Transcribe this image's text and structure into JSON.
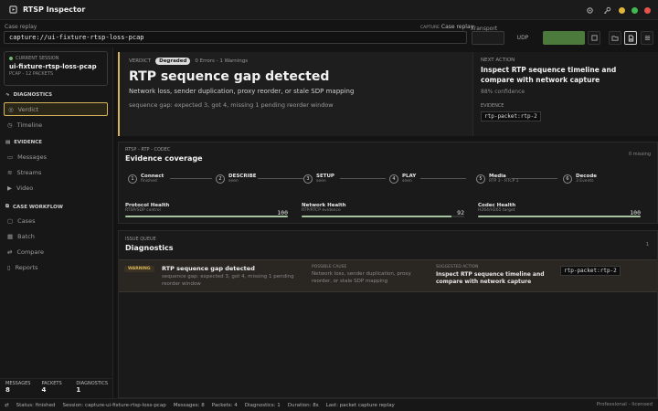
{
  "app": {
    "title": "RTSP Inspector"
  },
  "toolbar": {
    "case_replay_label": "Case replay",
    "address": "capture://ui-fixture-rtsp-loss-pcap",
    "capture_label": "CAPTURE",
    "capture_value": "Case replay",
    "transport_label": "Transport",
    "udp": "UDP"
  },
  "session": {
    "label": "CURRENT SESSION",
    "name": "ui-fixture-rtsp-loss-pcap",
    "meta": "PCAP - 12 PACKETS"
  },
  "sidebar": {
    "diagnostics": {
      "label": "DIAGNOSTICS",
      "items": [
        "Verdict",
        "Timeline"
      ]
    },
    "evidence": {
      "label": "EVIDENCE",
      "items": [
        "Messages",
        "Streams",
        "Video"
      ]
    },
    "workflow": {
      "label": "CASE WORKFLOW",
      "items": [
        "Cases",
        "Batch",
        "Compare",
        "Reports"
      ]
    }
  },
  "stats": [
    {
      "label": "MESSAGES",
      "value": "8"
    },
    {
      "label": "PACKETS",
      "value": "4"
    },
    {
      "label": "DIAGNOSTICS",
      "value": "1"
    }
  ],
  "verdict": {
    "label": "VERDICT",
    "badge": "Degraded",
    "counts": "0 Errors - 1 Warnings",
    "title": "RTP sequence gap detected",
    "subtitle": "Network loss, sender duplication, proxy reorder, or stale SDP mapping",
    "detail": "sequence gap: expected 3, got 4, missing 1 pending reorder window"
  },
  "next_action": {
    "label": "NEXT ACTION",
    "title": "Inspect RTP sequence timeline and compare with network capture",
    "confidence": "88% confidence",
    "evidence_label": "EVIDENCE",
    "evidence_chip": "rtp-packet:rtp-2"
  },
  "coverage": {
    "label": "RTSP - RTP - CODEC",
    "title": "Evidence coverage",
    "missing": "0 missing",
    "steps": [
      {
        "num": "1",
        "name": "Connect",
        "detail": "finished"
      },
      {
        "num": "2",
        "name": "DESCRIBE",
        "detail": "seen"
      },
      {
        "num": "3",
        "name": "SETUP",
        "detail": "seen"
      },
      {
        "num": "4",
        "name": "PLAY",
        "detail": "seen"
      },
      {
        "num": "5",
        "name": "Media",
        "detail": "RTP 3 - RTCP 1"
      },
      {
        "num": "6",
        "name": "Decode",
        "detail": "3 Events"
      }
    ],
    "health": [
      {
        "name": "Protocol Health",
        "sub": "RTSP/SDP control",
        "value": "100",
        "level": 100
      },
      {
        "name": "Network Health",
        "sub": "RTP/RTCP evidence",
        "value": "92",
        "level": 92
      },
      {
        "name": "Codec Health",
        "sub": "H264/H265 target",
        "value": "100",
        "level": 100
      }
    ]
  },
  "diagnostics": {
    "label": "ISSUE QUEUE",
    "title": "Diagnostics",
    "count": "1",
    "row": {
      "severity": "WARNING",
      "title": "RTP sequence gap detected",
      "detail": "sequence gap: expected 3, got 4, missing 1 pending reorder window",
      "cause_label": "POSSIBLE CAUSE",
      "cause": "Network loss, sender duplication, proxy reorder, or stale SDP mapping",
      "action_label": "SUGGESTED ACTION",
      "action": "Inspect RTP sequence timeline and compare with network capture",
      "chip": "rtp-packet:rtp-2"
    }
  },
  "statusbar": {
    "status": "Status: finished",
    "session": "Session: capture-ui-fixture-rtsp-loss-pcap",
    "messages": "Messages: 8",
    "packets": "Packets: 4",
    "diagnostics": "Diagnostics: 1",
    "duration": "Duration: 8s",
    "last": "Last: packet capture replay",
    "right": "Professional - licensed"
  },
  "colors": {
    "accent": "#d4b35a",
    "run": "#4c7a3d",
    "health_bar": "#a7c4a0"
  }
}
